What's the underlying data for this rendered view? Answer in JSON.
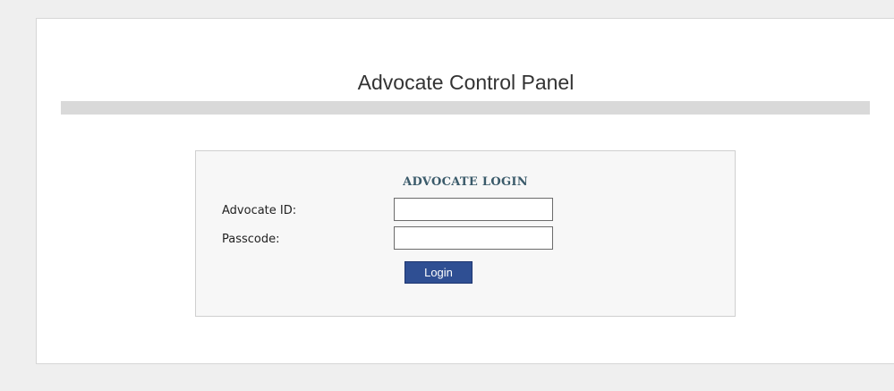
{
  "header": {
    "title": "Advocate Control Panel"
  },
  "login": {
    "heading": "ADVOCATE LOGIN",
    "advocate_id_label": "Advocate ID:",
    "advocate_id_value": "",
    "passcode_label": "Passcode:",
    "passcode_value": "",
    "button_label": "Login"
  },
  "colors": {
    "page_background": "#efefef",
    "panel_background": "#ffffff",
    "title_bar": "#d9d9d9",
    "login_box_background": "#f7f7f7",
    "heading_text": "#3a5a6a",
    "button_background": "#2f4f93",
    "button_text": "#ffffff"
  }
}
